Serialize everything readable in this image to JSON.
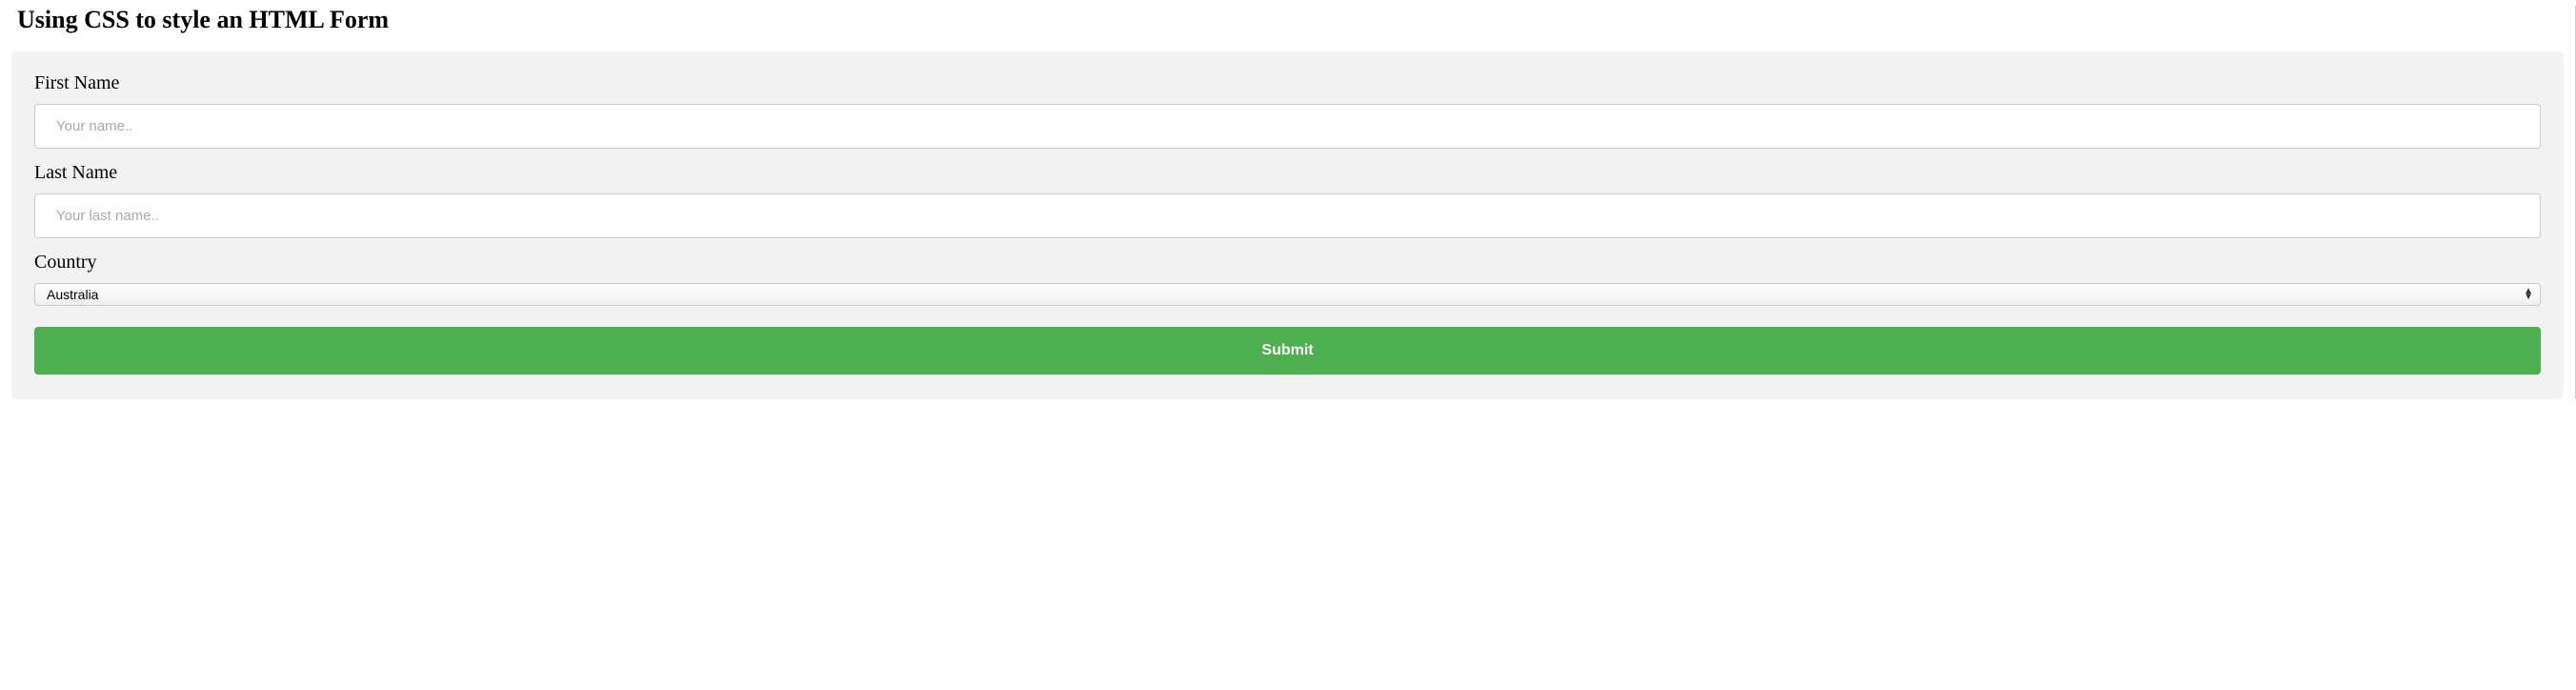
{
  "heading": "Using CSS to style an HTML Form",
  "form": {
    "first_name": {
      "label": "First Name",
      "placeholder": "Your name..",
      "value": ""
    },
    "last_name": {
      "label": "Last Name",
      "placeholder": "Your last name..",
      "value": ""
    },
    "country": {
      "label": "Country",
      "selected": "Australia"
    },
    "submit_label": "Submit"
  },
  "colors": {
    "form_bg": "#f2f2f2",
    "button_bg": "#4CAF50"
  }
}
